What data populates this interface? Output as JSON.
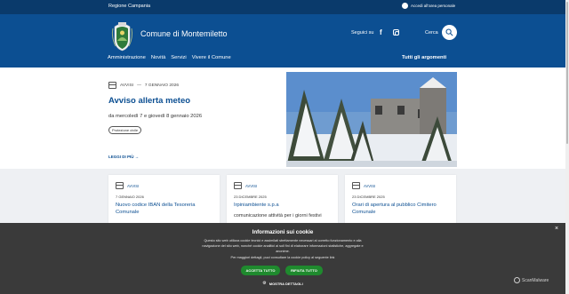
{
  "topbar": {
    "region": "Regione Campania",
    "login": "Accedi all'area personale"
  },
  "header": {
    "site_title": "Comune di Montemiletto",
    "follow_label": "Seguici su",
    "search_label": "Cerca",
    "icons": [
      "crest-logo",
      "facebook-icon",
      "instagram-icon",
      "search-icon"
    ]
  },
  "nav": {
    "items": [
      "Amministrazione",
      "Novità",
      "Servizi",
      "Vivere il Comune"
    ],
    "all_topics": "Tutti gli argomenti"
  },
  "hero": {
    "category": "AVVISI",
    "separator": "—",
    "date": "7 GENNAIO 2026",
    "title": "Avviso allerta meteo",
    "description": "da mercoledì 7 e giovedì 8 gennaio 2026",
    "tag": "Protezione civile",
    "read_more": "LEGGI DI PIÙ"
  },
  "cards": [
    {
      "category": "AVVISI",
      "date": "7 GENNAIO 2026",
      "title": "Nuovo codice IBAN della Tesoreria Comunale",
      "desc": ""
    },
    {
      "category": "AVVISI",
      "date": "23 DICEMBRE 2025",
      "title": "Irpiniambiente s.p.a",
      "desc": "comunicazione attività per i giorni festivi"
    },
    {
      "category": "AVVISI",
      "date": "23 DICEMBRE 2025",
      "title": "Orari di apertura al pubblico Cimitero Comunale",
      "desc": ""
    }
  ],
  "cookie": {
    "title": "Informazioni sui cookie",
    "text": "Questo sito web utilizza cookie tecnici e assimilati strettamente necessari al corretto funzionamento e alla navigazione del sito web, nonché cookie analitici ai soli fini di elaborare informazioni statistiche, aggregate e anonime.",
    "more": "Per maggiori dettagli, puoi consultare la cookie policy al seguente link",
    "accept": "ACCETTA TUTTO",
    "reject": "RIFIUTA TUTTO",
    "details": "MOSTRA DETTAGLI",
    "close": "×"
  },
  "watermark": "ScanMalware",
  "colors": {
    "brand_dark": "#0a3a6b",
    "brand": "#0c4f92",
    "accept_green": "#1f8a2e",
    "banner": "#3a3a3a"
  }
}
